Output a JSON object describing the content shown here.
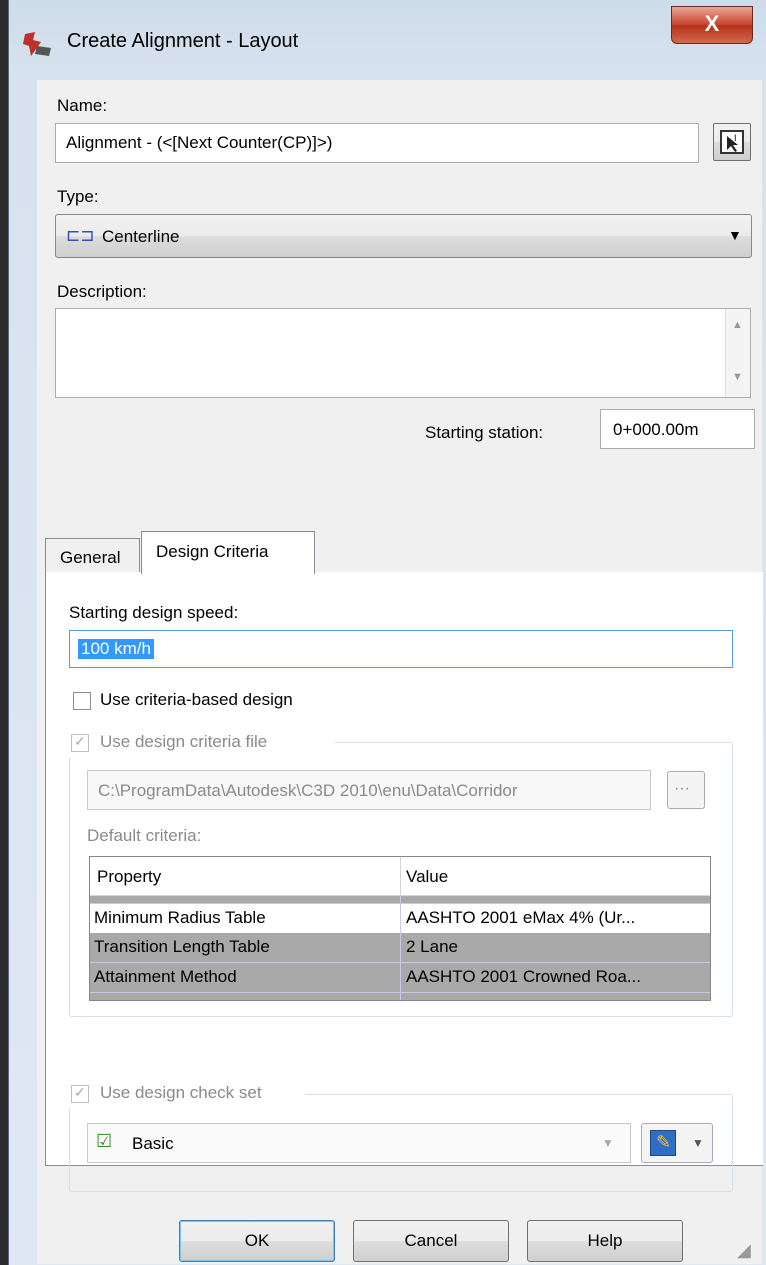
{
  "window": {
    "title": "Create Alignment - Layout",
    "close_label": "X"
  },
  "name": {
    "label": "Name:",
    "value": "Alignment - (<[Next Counter(CP)]>)"
  },
  "type": {
    "label": "Type:",
    "value": "Centerline"
  },
  "description": {
    "label": "Description:",
    "value": ""
  },
  "starting_station": {
    "label": "Starting station:",
    "value": "0+000.00m"
  },
  "tabs": [
    {
      "label": "General",
      "active": false
    },
    {
      "label": "Design Criteria",
      "active": true
    }
  ],
  "design_criteria": {
    "speed_label": "Starting design speed:",
    "speed_value": "100 km/h",
    "use_criteria_label": "Use criteria-based design",
    "use_file_label": "Use design criteria file",
    "file_path": "C:\\ProgramData\\Autodesk\\C3D 2010\\enu\\Data\\Corridor",
    "browse_label": "···",
    "default_criteria_label": "Default criteria:",
    "columns": [
      "Property",
      "Value"
    ],
    "rows": [
      {
        "property": "Minimum Radius Table",
        "value": "AASHTO 2001 eMax 4% (Ur..."
      },
      {
        "property": "Transition Length Table",
        "value": "2 Lane"
      },
      {
        "property": "Attainment Method",
        "value": "AASHTO 2001 Crowned Roa..."
      }
    ],
    "use_check_set_label": "Use design check set",
    "check_set_value": "Basic"
  },
  "buttons": {
    "ok": "OK",
    "cancel": "Cancel",
    "help": "Help"
  }
}
